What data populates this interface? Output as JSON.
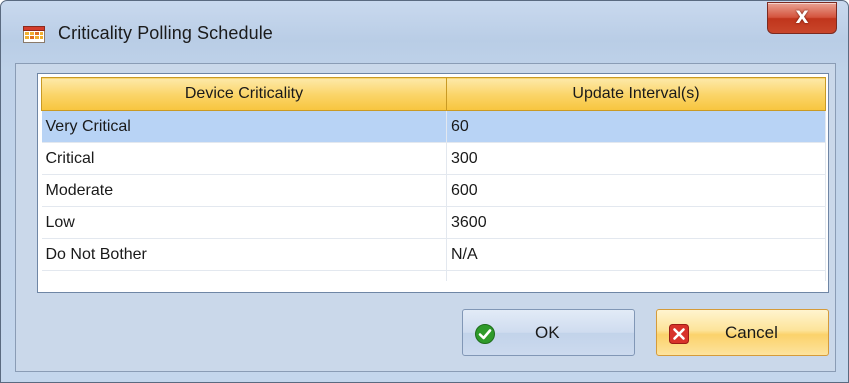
{
  "window": {
    "title": "Criticality Polling Schedule",
    "close_label": "X"
  },
  "grid": {
    "columns": [
      "Device Criticality",
      "Update Interval(s)"
    ],
    "rows": [
      {
        "criticality": "Very Critical",
        "interval": "60",
        "selected": true
      },
      {
        "criticality": "Critical",
        "interval": "300",
        "selected": false
      },
      {
        "criticality": "Moderate",
        "interval": "600",
        "selected": false
      },
      {
        "criticality": "Low",
        "interval": "3600",
        "selected": false
      },
      {
        "criticality": "Do Not Bother",
        "interval": "N/A",
        "selected": false
      }
    ]
  },
  "buttons": {
    "ok_label": "OK",
    "cancel_label": "Cancel"
  },
  "icons": {
    "app": "calendar-grid-icon",
    "ok": "green-check-icon",
    "cancel": "red-x-icon",
    "close": "close-icon"
  },
  "colors": {
    "header_gold": "#f7c53e",
    "selection_blue": "#b8d3f5",
    "close_red": "#c9462b",
    "ok_green": "#2e9a2a"
  }
}
